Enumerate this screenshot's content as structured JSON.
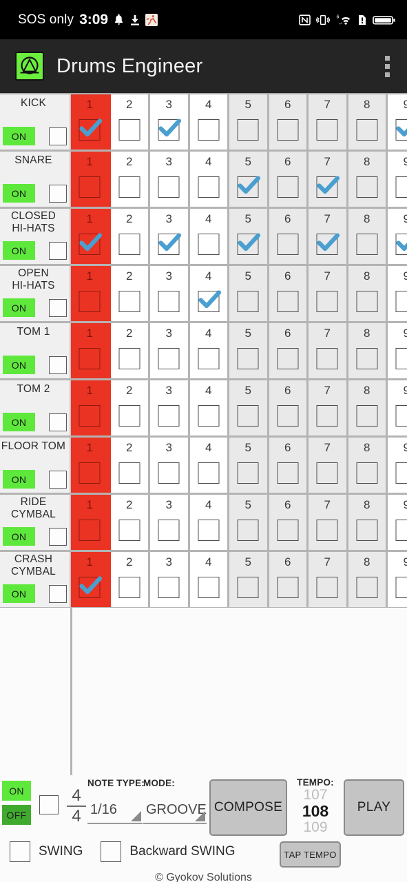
{
  "status_bar": {
    "carrier": "SOS only",
    "time": "3:09",
    "left_icons": [
      "bell-icon",
      "download-icon",
      "activity-icon"
    ],
    "right_icons": [
      "nfc-icon",
      "vibrate-icon",
      "wifi-icon",
      "sim-alert-icon",
      "battery-icon"
    ],
    "wifi_generation": "6"
  },
  "app_bar": {
    "title": "Drums Engineer",
    "logo_icon": "drums-engineer-logo",
    "overflow_icon": "overflow-menu-icon",
    "background": "#252525",
    "logo_color": "#6bee3e"
  },
  "grid": {
    "visible_steps": [
      1,
      2,
      3,
      4,
      5,
      6,
      7,
      8
    ],
    "partial_step": 9,
    "active_step": 1,
    "active_color": "#ea3323",
    "shaded_steps": [
      5,
      6,
      7,
      8
    ],
    "check_color": "#4a9fd0",
    "on_label": "ON",
    "rows": [
      {
        "name": "KICK",
        "name_lines": [
          "KICK"
        ],
        "enabled": "ON",
        "muted": false,
        "pattern": [
          true,
          false,
          true,
          false,
          false,
          false,
          false,
          false
        ],
        "partial_checked": true
      },
      {
        "name": "SNARE",
        "name_lines": [
          "SNARE"
        ],
        "enabled": "ON",
        "muted": false,
        "pattern": [
          false,
          false,
          false,
          false,
          true,
          false,
          true,
          false
        ],
        "partial_checked": false
      },
      {
        "name": "CLOSED HI-HATS",
        "name_lines": [
          "CLOSED",
          "HI-HATS"
        ],
        "enabled": "ON",
        "muted": false,
        "pattern": [
          true,
          false,
          true,
          false,
          true,
          false,
          true,
          false
        ],
        "partial_checked": true
      },
      {
        "name": "OPEN HI-HATS",
        "name_lines": [
          "OPEN",
          "HI-HATS"
        ],
        "enabled": "ON",
        "muted": false,
        "pattern": [
          false,
          false,
          false,
          true,
          false,
          false,
          false,
          false
        ],
        "partial_checked": false
      },
      {
        "name": "TOM 1",
        "name_lines": [
          "TOM 1"
        ],
        "enabled": "ON",
        "muted": false,
        "pattern": [
          false,
          false,
          false,
          false,
          false,
          false,
          false,
          false
        ],
        "partial_checked": false
      },
      {
        "name": "TOM 2",
        "name_lines": [
          "TOM 2"
        ],
        "enabled": "ON",
        "muted": false,
        "pattern": [
          false,
          false,
          false,
          false,
          false,
          false,
          false,
          false
        ],
        "partial_checked": false
      },
      {
        "name": "FLOOR TOM",
        "name_lines": [
          "FLOOR TOM"
        ],
        "enabled": "ON",
        "muted": false,
        "pattern": [
          false,
          false,
          false,
          false,
          false,
          false,
          false,
          false
        ],
        "partial_checked": false
      },
      {
        "name": "RIDE CYMBAL",
        "name_lines": [
          "RIDE",
          "CYMBAL"
        ],
        "enabled": "ON",
        "muted": false,
        "pattern": [
          false,
          false,
          false,
          false,
          false,
          false,
          false,
          false
        ],
        "partial_checked": false
      },
      {
        "name": "CRASH CYMBAL",
        "name_lines": [
          "CRASH",
          "CYMBAL"
        ],
        "enabled": "ON",
        "muted": false,
        "pattern": [
          true,
          false,
          false,
          false,
          false,
          false,
          false,
          false
        ],
        "partial_checked": false
      }
    ]
  },
  "controls": {
    "power": {
      "on_label": "ON",
      "off_label": "OFF",
      "selected": "ON"
    },
    "loop_checkbox_checked": false,
    "time_signature": {
      "numerator": "4",
      "denominator": "4"
    },
    "note_type": {
      "label": "NOTE TYPE:",
      "value": "1/16"
    },
    "mode": {
      "label": "MODE:",
      "value": "GROOVE"
    },
    "compose_button": "COMPOSE",
    "play_button": "PLAY",
    "tap_tempo_button": "TAP TEMPO",
    "tempo": {
      "label": "TEMPO:",
      "previous": "107",
      "current": "108",
      "next": "109"
    },
    "swing": {
      "label": "SWING",
      "checked": false
    },
    "backward_swing": {
      "label": "Backward SWING",
      "checked": false
    },
    "copyright": "© Gyokov Solutions"
  }
}
